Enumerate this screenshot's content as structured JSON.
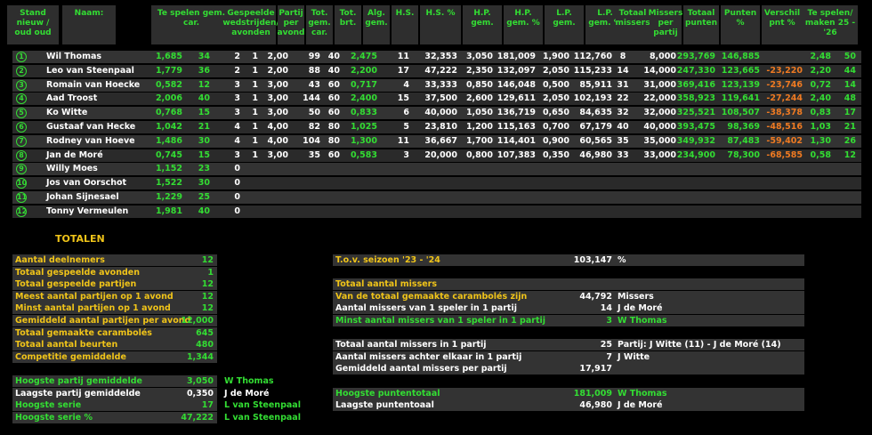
{
  "headers": [
    {
      "key": "stand",
      "text": "Stand nieuw / oud oud"
    },
    {
      "key": "naam",
      "text": "Naam:"
    },
    {
      "key": "te_spelen",
      "text": "Te spelen gem.  car."
    },
    {
      "key": "gespeelde",
      "text": "Gespeelde wedstrijden/ avonden"
    },
    {
      "key": "partij",
      "text": "Partij per avond"
    },
    {
      "key": "tot_gem",
      "text": "Tot. gem. car."
    },
    {
      "key": "tot_brt",
      "text": "Tot. brt."
    },
    {
      "key": "alg",
      "text": "Alg. gem."
    },
    {
      "key": "hs",
      "text": "H.S."
    },
    {
      "key": "hs_pct",
      "text": "H.S. %"
    },
    {
      "key": "hp",
      "text": "H.P. gem."
    },
    {
      "key": "hp_pct",
      "text": "H.P. gem. %"
    },
    {
      "key": "lp",
      "text": "L.P. gem."
    },
    {
      "key": "lp_gem",
      "text": "L.P. gem. %"
    },
    {
      "key": "tot_missers",
      "text": "Totaal missers"
    },
    {
      "key": "missers_per",
      "text": "Missers per partij"
    },
    {
      "key": "tot_punten",
      "text": "Totaal punten"
    },
    {
      "key": "punten_pct",
      "text": "Punten %"
    },
    {
      "key": "verschil",
      "text": "Verschil pnt %"
    },
    {
      "key": "te_spelen_maken",
      "text": "Te spelen/ maken 25 - '26"
    }
  ],
  "players": [
    {
      "rank": "1",
      "name": "Wil Thomas",
      "gem": "1,685",
      "car": "34",
      "wed": "2",
      "av": "1",
      "ppa": "2,00",
      "totcar": "99",
      "brt": "40",
      "alg": "2,475",
      "hs": "11",
      "hspct": "32,353",
      "hp": "3,050",
      "hppct": "181,009",
      "lp": "1,900",
      "lppct": "112,760",
      "miss": "8",
      "mpp": "8,000",
      "pnt": "293,769",
      "pntpct": "146,885",
      "vers": "",
      "ts": "2,48",
      "tm": "50"
    },
    {
      "rank": "2",
      "name": "Leo van Steenpaal",
      "gem": "1,779",
      "car": "36",
      "wed": "2",
      "av": "1",
      "ppa": "2,00",
      "totcar": "88",
      "brt": "40",
      "alg": "2,200",
      "hs": "17",
      "hspct": "47,222",
      "hp": "2,350",
      "hppct": "132,097",
      "lp": "2,050",
      "lppct": "115,233",
      "miss": "14",
      "mpp": "14,000",
      "pnt": "247,330",
      "pntpct": "123,665",
      "vers": "-23,220",
      "ts": "2,20",
      "tm": "44"
    },
    {
      "rank": "3",
      "name": "Romain van Hoecke",
      "gem": "0,582",
      "car": "12",
      "wed": "3",
      "av": "1",
      "ppa": "3,00",
      "totcar": "43",
      "brt": "60",
      "alg": "0,717",
      "hs": "4",
      "hspct": "33,333",
      "hp": "0,850",
      "hppct": "146,048",
      "lp": "0,500",
      "lppct": "85,911",
      "miss": "31",
      "mpp": "31,000",
      "pnt": "369,416",
      "pntpct": "123,139",
      "vers": "-23,746",
      "ts": "0,72",
      "tm": "14"
    },
    {
      "rank": "4",
      "name": "Aad Troost",
      "gem": "2,006",
      "car": "40",
      "wed": "3",
      "av": "1",
      "ppa": "3,00",
      "totcar": "144",
      "brt": "60",
      "alg": "2,400",
      "hs": "15",
      "hspct": "37,500",
      "hp": "2,600",
      "hppct": "129,611",
      "lp": "2,050",
      "lppct": "102,193",
      "miss": "22",
      "mpp": "22,000",
      "pnt": "358,923",
      "pntpct": "119,641",
      "vers": "-27,244",
      "ts": "2,40",
      "tm": "48"
    },
    {
      "rank": "5",
      "name": "Ko Witte",
      "gem": "0,768",
      "car": "15",
      "wed": "3",
      "av": "1",
      "ppa": "3,00",
      "totcar": "50",
      "brt": "60",
      "alg": "0,833",
      "hs": "6",
      "hspct": "40,000",
      "hp": "1,050",
      "hppct": "136,719",
      "lp": "0,650",
      "lppct": "84,635",
      "miss": "32",
      "mpp": "32,000",
      "pnt": "325,521",
      "pntpct": "108,507",
      "vers": "-38,378",
      "ts": "0,83",
      "tm": "17"
    },
    {
      "rank": "6",
      "name": "Gustaaf van Hecke",
      "gem": "1,042",
      "car": "21",
      "wed": "4",
      "av": "1",
      "ppa": "4,00",
      "totcar": "82",
      "brt": "80",
      "alg": "1,025",
      "hs": "5",
      "hspct": "23,810",
      "hp": "1,200",
      "hppct": "115,163",
      "lp": "0,700",
      "lppct": "67,179",
      "miss": "40",
      "mpp": "40,000",
      "pnt": "393,475",
      "pntpct": "98,369",
      "vers": "-48,516",
      "ts": "1,03",
      "tm": "21"
    },
    {
      "rank": "7",
      "name": "Rodney van Hoeve",
      "gem": "1,486",
      "car": "30",
      "wed": "4",
      "av": "1",
      "ppa": "4,00",
      "totcar": "104",
      "brt": "80",
      "alg": "1,300",
      "hs": "11",
      "hspct": "36,667",
      "hp": "1,700",
      "hppct": "114,401",
      "lp": "0,900",
      "lppct": "60,565",
      "miss": "35",
      "mpp": "35,000",
      "pnt": "349,932",
      "pntpct": "87,483",
      "vers": "-59,402",
      "ts": "1,30",
      "tm": "26"
    },
    {
      "rank": "8",
      "name": "Jan de Moré",
      "gem": "0,745",
      "car": "15",
      "wed": "3",
      "av": "1",
      "ppa": "3,00",
      "totcar": "35",
      "brt": "60",
      "alg": "0,583",
      "hs": "3",
      "hspct": "20,000",
      "hp": "0,800",
      "hppct": "107,383",
      "lp": "0,350",
      "lppct": "46,980",
      "miss": "33",
      "mpp": "33,000",
      "pnt": "234,900",
      "pntpct": "78,300",
      "vers": "-68,585",
      "ts": "0,58",
      "tm": "12"
    },
    {
      "rank": "9",
      "name": "Willy Moes",
      "gem": "1,152",
      "car": "23",
      "wed": "0",
      "av": "",
      "ppa": "",
      "totcar": "",
      "brt": "",
      "alg": "",
      "hs": "",
      "hspct": "",
      "hp": "",
      "hppct": "",
      "lp": "",
      "lppct": "",
      "miss": "",
      "mpp": "",
      "pnt": "",
      "pntpct": "",
      "vers": "",
      "ts": "",
      "tm": ""
    },
    {
      "rank": "10",
      "name": "Jos van Oorschot",
      "gem": "1,522",
      "car": "30",
      "wed": "0",
      "av": "",
      "ppa": "",
      "totcar": "",
      "brt": "",
      "alg": "",
      "hs": "",
      "hspct": "",
      "hp": "",
      "hppct": "",
      "lp": "",
      "lppct": "",
      "miss": "",
      "mpp": "",
      "pnt": "",
      "pntpct": "",
      "vers": "",
      "ts": "",
      "tm": ""
    },
    {
      "rank": "11",
      "name": "Johan Sijnesael",
      "gem": "1,229",
      "car": "25",
      "wed": "0",
      "av": "",
      "ppa": "",
      "totcar": "",
      "brt": "",
      "alg": "",
      "hs": "",
      "hspct": "",
      "hp": "",
      "hppct": "",
      "lp": "",
      "lppct": "",
      "miss": "",
      "mpp": "",
      "pnt": "",
      "pntpct": "",
      "vers": "",
      "ts": "",
      "tm": ""
    },
    {
      "rank": "12",
      "name": "Tonny Vermeulen",
      "gem": "1,981",
      "car": "40",
      "wed": "0",
      "av": "",
      "ppa": "",
      "totcar": "",
      "brt": "",
      "alg": "",
      "hs": "",
      "hspct": "",
      "hp": "",
      "hppct": "",
      "lp": "",
      "lppct": "",
      "miss": "",
      "mpp": "",
      "pnt": "",
      "pntpct": "",
      "vers": "",
      "ts": "",
      "tm": ""
    }
  ],
  "totalen_title": "TOTALEN",
  "left_stats": [
    {
      "label": "Aantal deelnemers",
      "value": "12",
      "extra": "",
      "lc": "y",
      "vc": "g",
      "ec": "w"
    },
    {
      "label": "Totaal gespeelde avonden",
      "value": "1",
      "extra": "",
      "lc": "y",
      "vc": "g",
      "ec": "w"
    },
    {
      "label": "Totaal gespeelde partijen",
      "value": "12",
      "extra": "",
      "lc": "y",
      "vc": "g",
      "ec": "w"
    },
    {
      "label": "Meest aantal partijen op 1 avond",
      "value": "12",
      "extra": "",
      "lc": "y",
      "vc": "g",
      "ec": "w"
    },
    {
      "label": "Minst aantal partijen op 1 avond",
      "value": "12",
      "extra": "",
      "lc": "y",
      "vc": "g",
      "ec": "w"
    },
    {
      "label": "Gemiddeld aantal partijen per avond",
      "value": "12,000",
      "extra": "",
      "lc": "y",
      "vc": "g",
      "ec": "w"
    },
    {
      "label": "Totaal gemaakte carambolés",
      "value": "645",
      "extra": "",
      "lc": "y",
      "vc": "g",
      "ec": "w"
    },
    {
      "label": "Totaal aantal beurten",
      "value": "480",
      "extra": "",
      "lc": "y",
      "vc": "g",
      "ec": "w"
    },
    {
      "label": "Competitie gemiddelde",
      "value": "1,344",
      "extra": "",
      "lc": "y",
      "vc": "g",
      "ec": "w"
    },
    {
      "label": "",
      "value": "",
      "extra": "",
      "lc": "y",
      "vc": "g",
      "ec": "w"
    },
    {
      "label": "Hoogste partij gemiddelde",
      "value": "3,050",
      "extra": "W Thomas",
      "lc": "g",
      "vc": "g",
      "ec": "g"
    },
    {
      "label": "Laagste partij gemiddelde",
      "value": "0,350",
      "extra": "J de Moré",
      "lc": "w",
      "vc": "w",
      "ec": "w"
    },
    {
      "label": "Hoogste serie",
      "value": "17",
      "extra": "L van Steenpaal",
      "lc": "g",
      "vc": "g",
      "ec": "g"
    },
    {
      "label": "Hoogste serie %",
      "value": "47,222",
      "extra": "L van Steenpaal",
      "lc": "g",
      "vc": "g",
      "ec": "g"
    }
  ],
  "right_stats": [
    {
      "label": "T.o.v. seizoen '23 - '24",
      "value": "103,147",
      "extra": "%",
      "lc": "y",
      "vc": "w",
      "ec": "w"
    },
    {
      "label": "",
      "value": "",
      "extra": "",
      "lc": "y",
      "vc": "w",
      "ec": "w"
    },
    {
      "label": "Totaal aantal missers",
      "value": "",
      "extra": "",
      "lc": "y",
      "vc": "w",
      "ec": "w"
    },
    {
      "label": "Van de totaal gemaakte carambolés zijn",
      "value": "44,792",
      "extra": "Missers",
      "lc": "y",
      "vc": "w",
      "ec": "w"
    },
    {
      "label": "Aantal missers van 1 speler in 1 partij",
      "value": "14",
      "extra": "J de Moré",
      "lc": "w",
      "vc": "w",
      "ec": "w"
    },
    {
      "label": "Minst aantal missers van 1 speler in 1 partij",
      "value": "3",
      "extra": "W Thomas",
      "lc": "g",
      "vc": "g",
      "ec": "g"
    },
    {
      "label": "",
      "value": "",
      "extra": "",
      "lc": "w",
      "vc": "w",
      "ec": "w"
    },
    {
      "label": "Totaal aantal missers in 1 partij",
      "value": "25",
      "extra": "Partij: J Witte (11) - J de Moré (14)",
      "lc": "w",
      "vc": "w",
      "ec": "w"
    },
    {
      "label": "Aantal missers achter elkaar in 1 partij",
      "value": "7",
      "extra": "J Witte",
      "lc": "w",
      "vc": "w",
      "ec": "w"
    },
    {
      "label": "Gemiddeld aantal missers per partij",
      "value": "17,917",
      "extra": "",
      "lc": "w",
      "vc": "w",
      "ec": "w"
    },
    {
      "label": "",
      "value": "",
      "extra": "",
      "lc": "w",
      "vc": "w",
      "ec": "w"
    },
    {
      "label": "Hoogste puntentotaal",
      "value": "181,009",
      "extra": "W Thomas",
      "lc": "g",
      "vc": "g",
      "ec": "g"
    },
    {
      "label": "Laagste puntentoaal",
      "value": "46,980",
      "extra": "J de Moré",
      "lc": "w",
      "vc": "w",
      "ec": "w"
    }
  ]
}
